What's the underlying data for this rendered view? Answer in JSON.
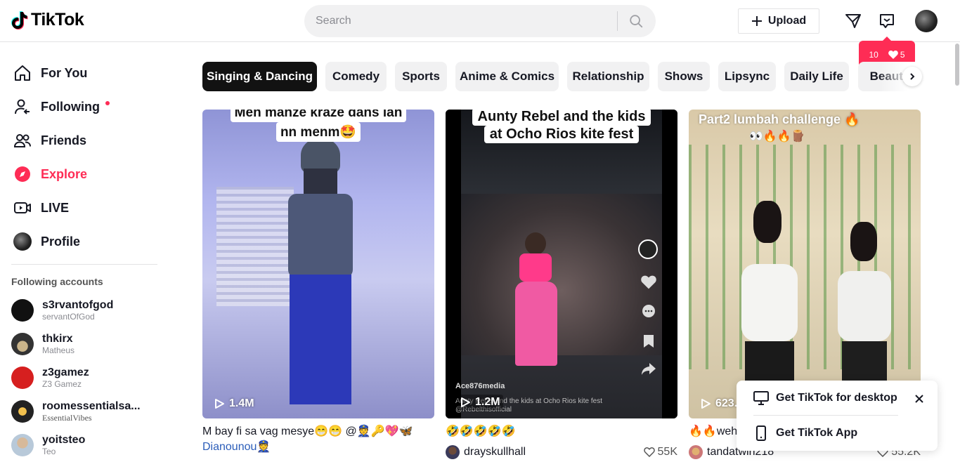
{
  "header": {
    "logo_text": "TikTok",
    "search_placeholder": "Search",
    "upload_label": "Upload",
    "notifications": {
      "followers": "10",
      "likes": "5"
    }
  },
  "sidebar": {
    "nav": [
      {
        "label": "For You",
        "icon": "home-icon"
      },
      {
        "label": "Following",
        "icon": "following-icon"
      },
      {
        "label": "Friends",
        "icon": "friends-icon"
      },
      {
        "label": "Explore",
        "icon": "explore-icon"
      },
      {
        "label": "LIVE",
        "icon": "live-icon"
      },
      {
        "label": "Profile",
        "icon": "profile-avatar"
      }
    ],
    "following_title": "Following accounts",
    "accounts": [
      {
        "name": "s3rvantofgod",
        "sub": "servantOfGod"
      },
      {
        "name": "thkirx",
        "sub": "Matheus"
      },
      {
        "name": "z3gamez",
        "sub": "Z3 Gamez"
      },
      {
        "name": "roomessentialsa...",
        "sub": "EssentialVibes"
      },
      {
        "name": "yoitsteo",
        "sub": "Teo"
      }
    ]
  },
  "categories": [
    "Singing & Dancing",
    "Comedy",
    "Sports",
    "Anime & Comics",
    "Relationship",
    "Shows",
    "Lipsync",
    "Daily Life",
    "Beauty"
  ],
  "videos": [
    {
      "overlay_line1": "Men manze kraze dans lan",
      "overlay_line2": "nn menm🤩",
      "views": "1.4M",
      "caption": "M bay fi sa vag mesye😁😁 @👮🔑💖🦋",
      "caption_tag": "Dianounou👮",
      "author": "",
      "likes": ""
    },
    {
      "overlay_line1": "Aunty Rebel and the kids",
      "overlay_line2": "at Ocho Rios kite fest",
      "watermark": "Ace876media",
      "sub_caption": "Aunty Rebel and the kids at Ocho Rios kite fest @Rebelthisofficial",
      "views": "1.2M",
      "caption": "🤣🤣🤣🤣🤣",
      "author": "drayskullhall",
      "likes": "55K"
    },
    {
      "overlay_line1": "Part2 lumbah challenge 🔥",
      "overlay_line2": "👀🔥🔥🪵",
      "views": "623.",
      "caption": "🔥🔥weh",
      "author": "tandatwin218",
      "likes": "55.2K"
    }
  ],
  "popup": {
    "desktop_label": "Get TikTok for desktop",
    "app_label": "Get TikTok App"
  },
  "colors": {
    "accent": "#fe2c55",
    "text": "#161823"
  }
}
